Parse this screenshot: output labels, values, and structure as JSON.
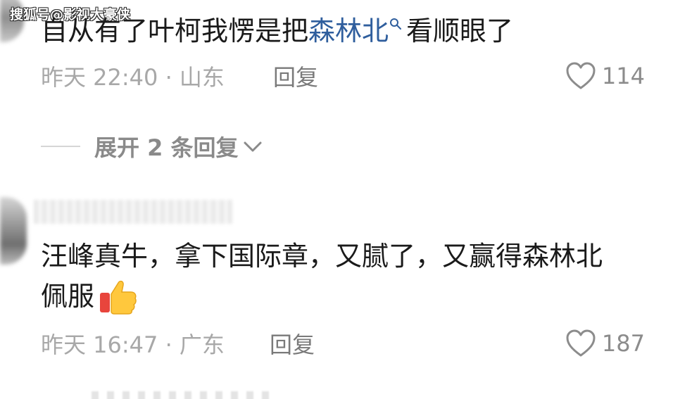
{
  "watermark": "搜狐号@影视大豪侠",
  "comments": [
    {
      "text_before": "自从有了叶柯我愣是把",
      "link_term": "森林北",
      "text_after": "看顺眼了",
      "time": "昨天 22:40 · 山东",
      "reply_label": "回复",
      "like_count": "114",
      "expand_label": "展开 2 条回复"
    },
    {
      "line1": "汪峰真牛，拿下国际章，又腻了，又赢得森林北",
      "line2": "佩服",
      "emoji": "thumbs-up-emoji",
      "time": "昨天 16:47 · 广东",
      "reply_label": "回复",
      "like_count": "187"
    }
  ],
  "colors": {
    "link": "#2f5e9d",
    "meta": "#a8a8a8",
    "text": "#1a1a1a"
  },
  "icons": [
    "search-icon",
    "heart-icon",
    "chevron-down-icon"
  ]
}
